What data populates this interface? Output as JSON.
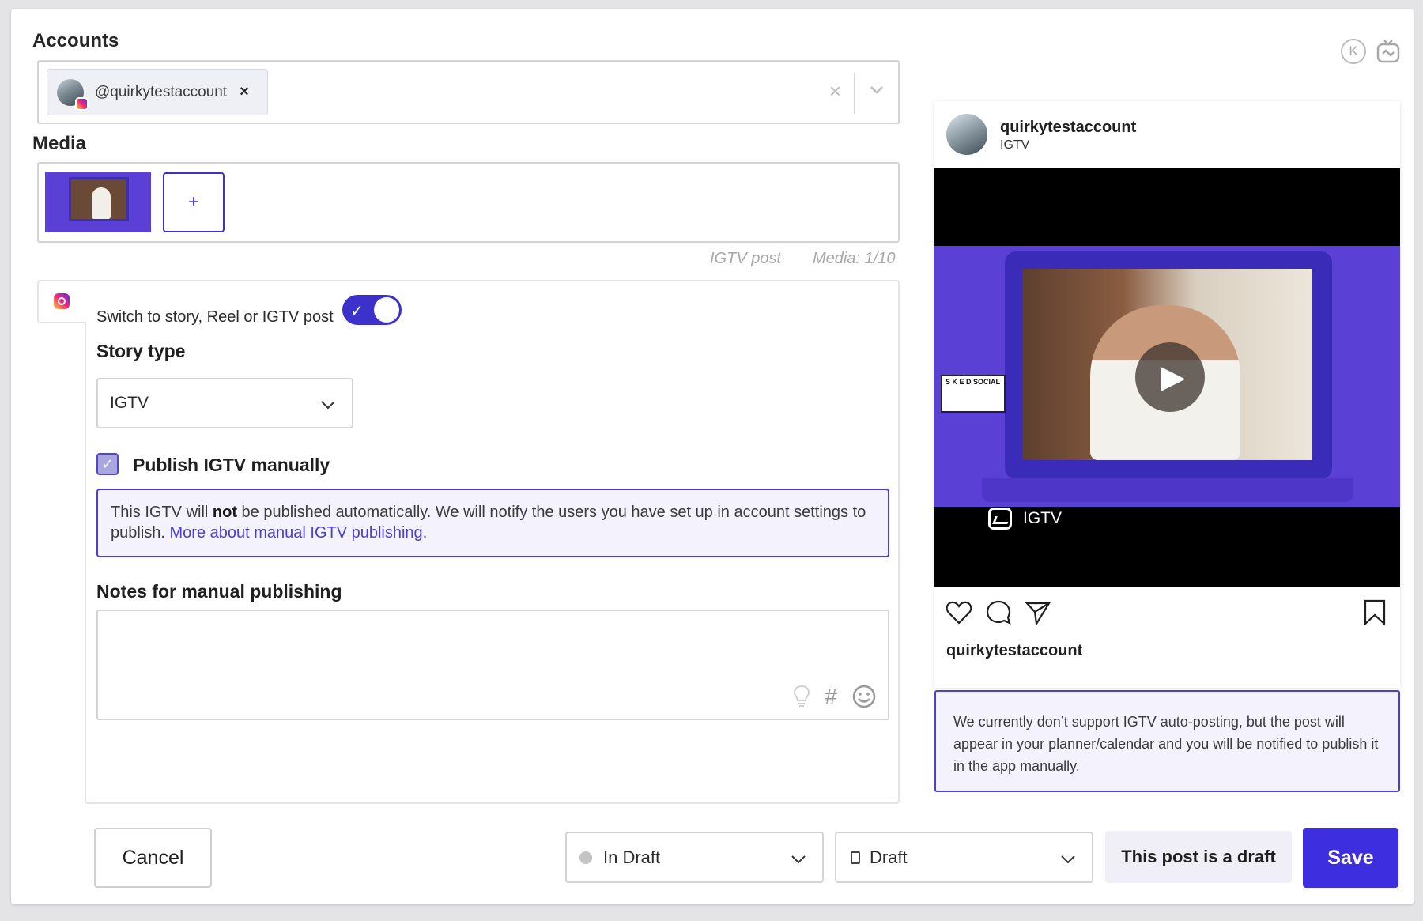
{
  "accounts": {
    "label": "Accounts",
    "selected": [
      {
        "handle": "@quirkytestaccount",
        "platform": "instagram"
      }
    ],
    "remove_icon": "close-icon",
    "clear_icon": "clear-icon",
    "dropdown_icon": "chevron-down-icon"
  },
  "media": {
    "label": "Media",
    "add_label": "+",
    "post_type": "IGTV post",
    "count": "Media: 1/10"
  },
  "story": {
    "switch_label": "Switch to story, Reel or IGTV post",
    "switch_on": true,
    "type_label": "Story type",
    "type_value": "IGTV",
    "publish_manually_label": "Publish IGTV manually",
    "publish_manually_checked": true,
    "notice_part1": "This IGTV will ",
    "notice_bold": "not",
    "notice_part2": " be published automatically. We will notify the users you have set up in account settings to publish. ",
    "notice_link": "More about manual IGTV publishing",
    "notice_end": ".",
    "notes_label": "Notes for manual publishing",
    "notes_value": "",
    "notes_icons": [
      "lightbulb-icon",
      "hashtag-icon",
      "emoji-icon"
    ]
  },
  "footer": {
    "cancel_label": "Cancel",
    "status_value": "In Draft",
    "draft_value": "Draft",
    "draft_note": "This post is a draft",
    "save_label": "Save"
  },
  "top_icons": {
    "k_label": "K"
  },
  "preview": {
    "username": "quirkytestaccount",
    "subtitle": "IGTV",
    "badge_label": "IGTV",
    "sked_text": "S K E D SOCIAL",
    "caption_user": "quirkytestaccount",
    "action_icons": [
      "heart-icon",
      "comment-icon",
      "share-icon",
      "bookmark-icon"
    ],
    "notice": "We currently don’t support IGTV auto-posting, but the post will appear in your planner/calendar and you will be notified to publish it in the app manually."
  },
  "colors": {
    "accent": "#3d2ee0",
    "notice_border": "#4c3fd0",
    "notice_bg": "#f3f2fd",
    "video_purple": "#5b40d6"
  }
}
